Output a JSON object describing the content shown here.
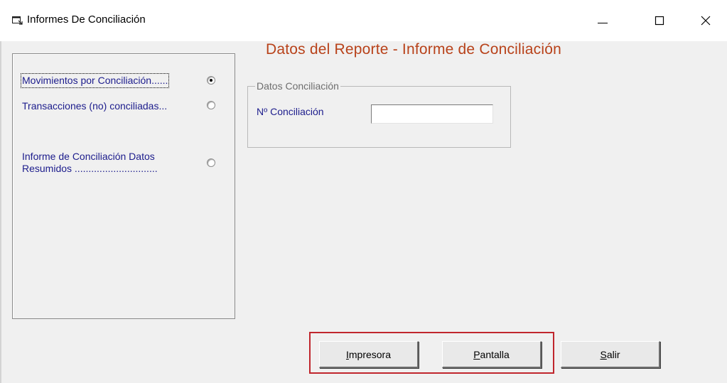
{
  "window": {
    "title": "Informes De Conciliación",
    "controls": [
      "minimize-icon",
      "maximize-icon",
      "close-icon"
    ]
  },
  "left_panel": {
    "options": [
      {
        "label": "Movimientos por Conciliación......",
        "selected": true
      },
      {
        "label": "Transacciones (no) conciliadas...",
        "selected": false
      },
      {
        "label_line1": "Informe de Conciliación Datos",
        "label_line2": "Resumidos ..............................",
        "selected": false
      }
    ]
  },
  "main": {
    "title": "Datos del Reporte - Informe de Conciliación",
    "group": {
      "legend": "Datos Conciliación",
      "field_label": "Nº Conciliación",
      "field_value": ""
    }
  },
  "buttons": {
    "impresora": {
      "hotkey": "I",
      "rest": "mpresora"
    },
    "pantalla": {
      "hotkey": "P",
      "rest": "antalla"
    },
    "salir": {
      "hotkey": "S",
      "rest": "alir"
    }
  },
  "colors": {
    "title_accent": "#b8421a",
    "label_text": "#1c1c8c",
    "highlight_border": "#c0262d"
  }
}
